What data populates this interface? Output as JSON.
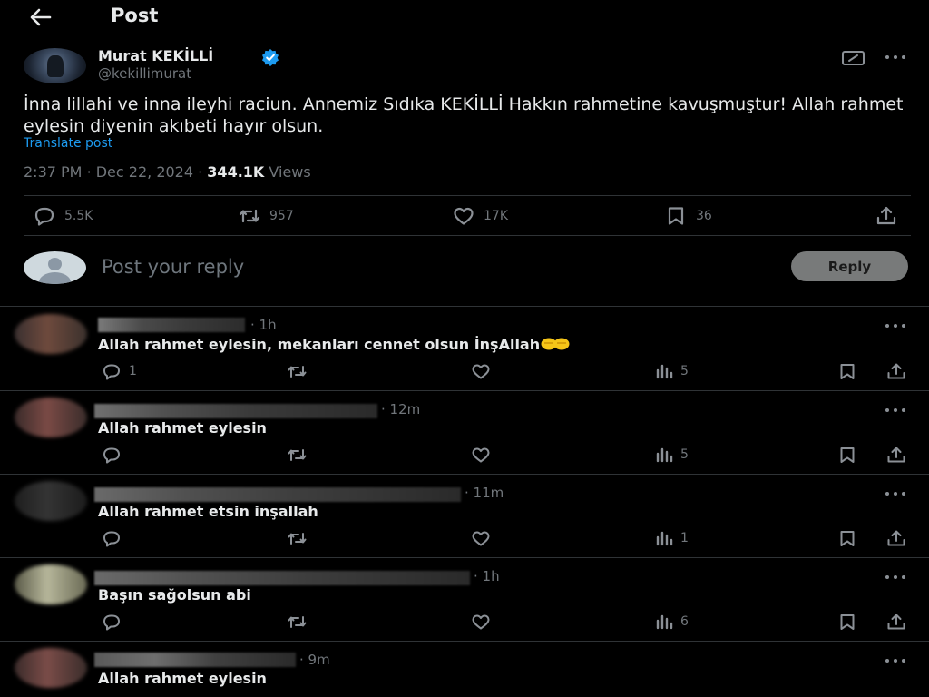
{
  "header": {
    "title": "Post"
  },
  "post": {
    "author_name": "Murat KEKİLLİ",
    "author_handle": "@kekillimurat",
    "text": "İnna lillahi ve inna ileyhi raciun. Annemiz Sıdıka KEKİLLİ Hakkın rahmetine kavuşmuştur! Allah rahmet eylesin diyenin akıbeti hayır olsun.",
    "translate_label": "Translate post",
    "time": "2:37 PM",
    "date": "Dec 22, 2024",
    "views_count": "344.1K",
    "views_label": "Views",
    "stats": {
      "replies": "5.5K",
      "reposts": "957",
      "likes": "17K",
      "bookmarks": "36"
    }
  },
  "composer": {
    "placeholder": "Post your reply",
    "button_label": "Reply"
  },
  "replies": [
    {
      "time": "· 1h",
      "text": "Allah rahmet eylesin, mekanları cennet olsun İnşAllah",
      "emoji": "open-hands-icon",
      "replies": "1",
      "reposts": "",
      "likes": "",
      "views": "5"
    },
    {
      "time": "· 12m",
      "text": "Allah rahmet eylesin",
      "replies": "",
      "reposts": "",
      "likes": "",
      "views": "5"
    },
    {
      "time": "· 11m",
      "text": "Allah rahmet etsin inşallah",
      "replies": "",
      "reposts": "",
      "likes": "",
      "views": "1"
    },
    {
      "time": "· 1h",
      "text": "Başın sağolsun abi",
      "replies": "",
      "reposts": "",
      "likes": "",
      "views": "6"
    },
    {
      "time": "· 9m",
      "text": "Allah rahmet eylesin"
    }
  ],
  "colors": {
    "background": "#000000",
    "text_primary": "#e7e9ea",
    "text_secondary": "#71767b",
    "link": "#1d9bf0",
    "verified": "#1d9bf0",
    "divider": "#2f3336",
    "reply_button": "#787a7a"
  }
}
